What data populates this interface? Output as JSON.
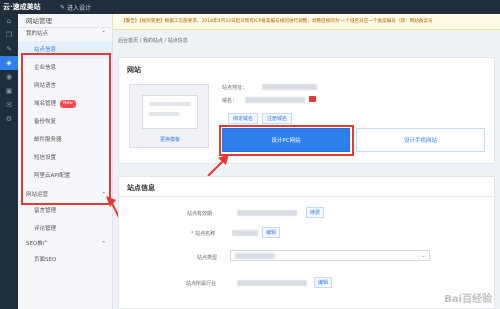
{
  "topbar": {
    "brand": "云·速成美站",
    "enter_label": "进入设计"
  },
  "sidebar": {
    "title": "网站管理",
    "group1": "我的站点",
    "items": [
      "站点信息",
      "企业信息",
      "网站语言",
      "域名管理",
      "备份恢复",
      "邮件服务器",
      "短信设置",
      "阿里云API配置"
    ],
    "new_badge": "New",
    "group2": "网站运营",
    "items2": [
      "留言管理",
      "评论管理"
    ],
    "group3": "SEO推广",
    "items3": [
      "页面SEO"
    ]
  },
  "notice": "【警告】【规则变更】根据工信部要求，2018年4月22日起对现有ICP备案编号规则进行调整，调整后规则为'一个域名对应一个备案编号（即：网站备案号",
  "breadcrumb": [
    "后台首页",
    "我的站点",
    "站点信息"
  ],
  "site_card": {
    "title": "网站",
    "preview_label": "更换模板",
    "address_label": "站点地址：",
    "domain_label": "域名：",
    "bind_domain": "绑定域名",
    "register_domain": "注册域名",
    "design_pc": "设计PC网站",
    "design_mobile": "设计手机网站"
  },
  "info_card": {
    "title": "站点信息",
    "status_label": "站点有效期",
    "status_btn": "续费",
    "name_label": "* 站点名称",
    "name_btn": "编辑",
    "type_label": "站点类型",
    "industry_label": "站点所属行业",
    "industry_btn": "编辑"
  },
  "watermark": "Bai百经验"
}
